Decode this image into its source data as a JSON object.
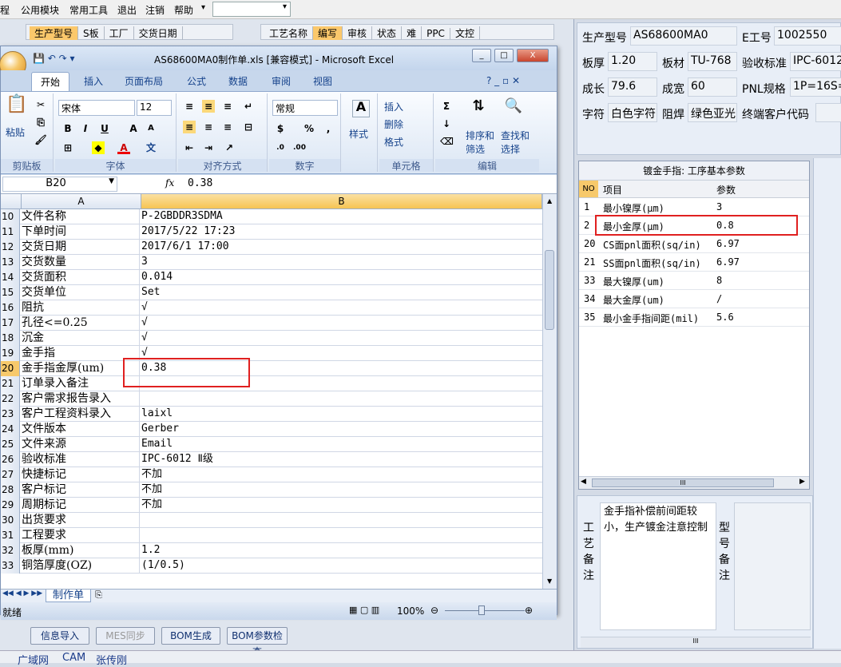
{
  "topmenu": {
    "items": [
      "程",
      "公用模块",
      "常用工具",
      "退出",
      "注销",
      "帮助"
    ],
    "dropdown_arrow": "▾"
  },
  "bg_header": {
    "cols1": [
      "生产型号",
      "S板",
      "工厂",
      "交货日期"
    ],
    "cols2": [
      "工艺名称",
      "编写",
      "审核",
      "状态",
      "难",
      "PPC",
      "文控"
    ]
  },
  "bottom_buttons": [
    "信息导入",
    "MES同步",
    "BOM生成",
    "BOM参数检查"
  ],
  "taskbar": [
    "广域网",
    "CAM",
    "张传刚"
  ],
  "info": {
    "rows": [
      [
        {
          "label": "生产型号",
          "value": "AS68600MA0"
        },
        {
          "label": "E工号",
          "value": "1002550"
        }
      ],
      [
        {
          "label": "板厚",
          "value": "1.20"
        },
        {
          "label": "板材",
          "value": "TU-768"
        },
        {
          "label": "验收标准",
          "value": "IPC-6012"
        }
      ],
      [
        {
          "label": "成长",
          "value": "79.6"
        },
        {
          "label": "成宽",
          "value": "60"
        },
        {
          "label": "PNL规格",
          "value": "1P=16S="
        }
      ],
      [
        {
          "label": "字符",
          "value": "白色字符"
        },
        {
          "label": "阻焊",
          "value": "绿色亚光"
        },
        {
          "label": "终端客户代码",
          "value": ""
        }
      ]
    ]
  },
  "grid": {
    "title": "镀金手指: 工序基本参数",
    "headers": [
      "NO",
      "项目",
      "参数"
    ],
    "rows": [
      {
        "no": "1",
        "item": "最小镍厚(μm)",
        "param": "3"
      },
      {
        "no": "2",
        "item": "最小金厚(μm)",
        "param": "0.8"
      },
      {
        "no": "20",
        "item": "CS面pnl面积(sq/in)",
        "param": "6.97"
      },
      {
        "no": "21",
        "item": "SS面pnl面积(sq/in)",
        "param": "6.97"
      },
      {
        "no": "33",
        "item": "最大镍厚(um)",
        "param": "8"
      },
      {
        "no": "34",
        "item": "最大金厚(um)",
        "param": "/"
      },
      {
        "no": "35",
        "item": "最小金手指间距(mil)",
        "param": "5.6"
      }
    ],
    "scroll_mark": "III"
  },
  "memo": {
    "label1": "工艺备注",
    "label2": "型号备注",
    "text": "金手指补偿前间距较小，生产镀金注意控制",
    "scroll_mark": "III"
  },
  "excel": {
    "title": "AS68600MA0制作单.xls [兼容模式] - Microsoft Excel",
    "tabs": [
      "开始",
      "插入",
      "页面布局",
      "公式",
      "数据",
      "审阅",
      "视图"
    ],
    "ribbon": {
      "paste": "粘贴",
      "clipboard": "剪贴板",
      "font_name": "宋体",
      "font_size": "12",
      "font_group": "字体",
      "align_group": "对齐方式",
      "num_format": "常规",
      "num_group": "数字",
      "style_btn": "样式",
      "insert": "插入",
      "delete": "删除",
      "format": "格式",
      "cells_group": "单元格",
      "sort": "排序和筛选",
      "find": "查找和选择",
      "edit_group": "编辑",
      "font_color_letter": "A",
      "bold": "B",
      "italic": "I",
      "underline": "U",
      "wen": "文",
      "percent": "%",
      "comma": ","
    },
    "namebox": "B20",
    "fx": "fx",
    "formula_value": "0.38",
    "col_a": "A",
    "col_b": "B",
    "rows": [
      {
        "n": "10",
        "a": "文件名称",
        "b": "P-2GBDDR3SDMA"
      },
      {
        "n": "11",
        "a": "下单时间",
        "b": "2017/5/22 17:23"
      },
      {
        "n": "12",
        "a": "交货日期",
        "b": "2017/6/1 17:00"
      },
      {
        "n": "13",
        "a": "交货数量",
        "b": "3"
      },
      {
        "n": "14",
        "a": "交货面积",
        "b": "0.014"
      },
      {
        "n": "15",
        "a": "交货单位",
        "b": "Set"
      },
      {
        "n": "16",
        "a": "阻抗",
        "b": "√"
      },
      {
        "n": "17",
        "a": "孔径<=0.25",
        "b": "√"
      },
      {
        "n": "18",
        "a": "沉金",
        "b": "√"
      },
      {
        "n": "19",
        "a": "金手指",
        "b": "√"
      },
      {
        "n": "20",
        "a": "金手指金厚(um)",
        "b": "0.38"
      },
      {
        "n": "21",
        "a": "订单录入备注",
        "b": ""
      },
      {
        "n": "22",
        "a": "客户需求报告录入",
        "b": ""
      },
      {
        "n": "23",
        "a": "客户工程资料录入",
        "b": "laixl"
      },
      {
        "n": "24",
        "a": "文件版本",
        "b": "Gerber"
      },
      {
        "n": "25",
        "a": "文件来源",
        "b": "Email"
      },
      {
        "n": "26",
        "a": "验收标准",
        "b": "IPC-6012 Ⅱ级"
      },
      {
        "n": "27",
        "a": "快捷标记",
        "b": "不加"
      },
      {
        "n": "28",
        "a": "客户标记",
        "b": "不加"
      },
      {
        "n": "29",
        "a": "周期标记",
        "b": "不加"
      },
      {
        "n": "30",
        "a": "出货要求",
        "b": ""
      },
      {
        "n": "31",
        "a": "工程要求",
        "b": ""
      },
      {
        "n": "32",
        "a": "板厚(mm)",
        "b": "1.2"
      },
      {
        "n": "33",
        "a": "铜箔厚度(OZ)",
        "b": " (1/0.5)"
      }
    ],
    "sheet_tab": "制作单",
    "status": "就绪",
    "zoom": "100%",
    "win_buttons": [
      "_",
      "□",
      "X"
    ]
  }
}
